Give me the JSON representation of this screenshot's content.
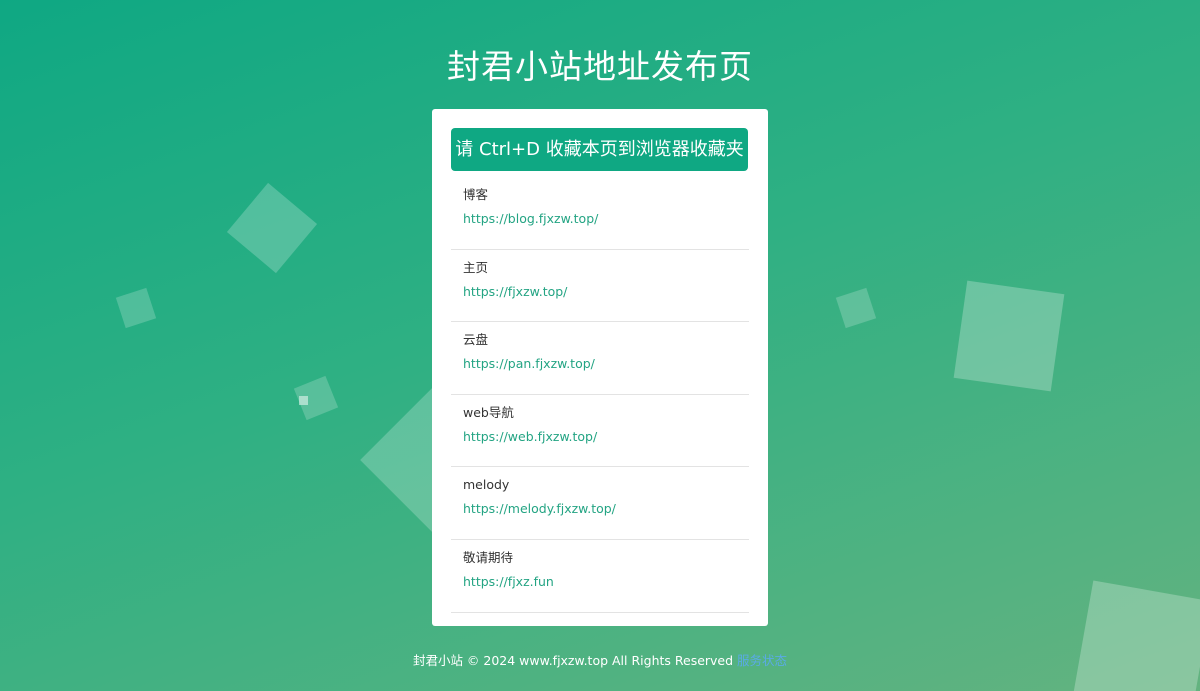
{
  "header": {
    "title": "封君小站地址发布页"
  },
  "card": {
    "banner": "请 Ctrl+D 收藏本页到浏览器收藏夹",
    "sites": [
      {
        "name": "博客",
        "url": "https://blog.fjxzw.top/"
      },
      {
        "name": "主页",
        "url": "https://fjxzw.top/"
      },
      {
        "name": "云盘",
        "url": "https://pan.fjxzw.top/"
      },
      {
        "name": "web导航",
        "url": "https://web.fjxzw.top/"
      },
      {
        "name": "melody",
        "url": "https://melody.fjxzw.top/"
      },
      {
        "name": "敬请期待",
        "url": "https://fjxz.fun"
      }
    ]
  },
  "footer": {
    "copyright": "封君小站 © 2024 www.fjxzw.top All Rights Reserved",
    "status_link": "服务状态"
  },
  "colors": {
    "accent": "#0fa883",
    "link": "#23a483",
    "footer_link": "#5aaae6"
  }
}
